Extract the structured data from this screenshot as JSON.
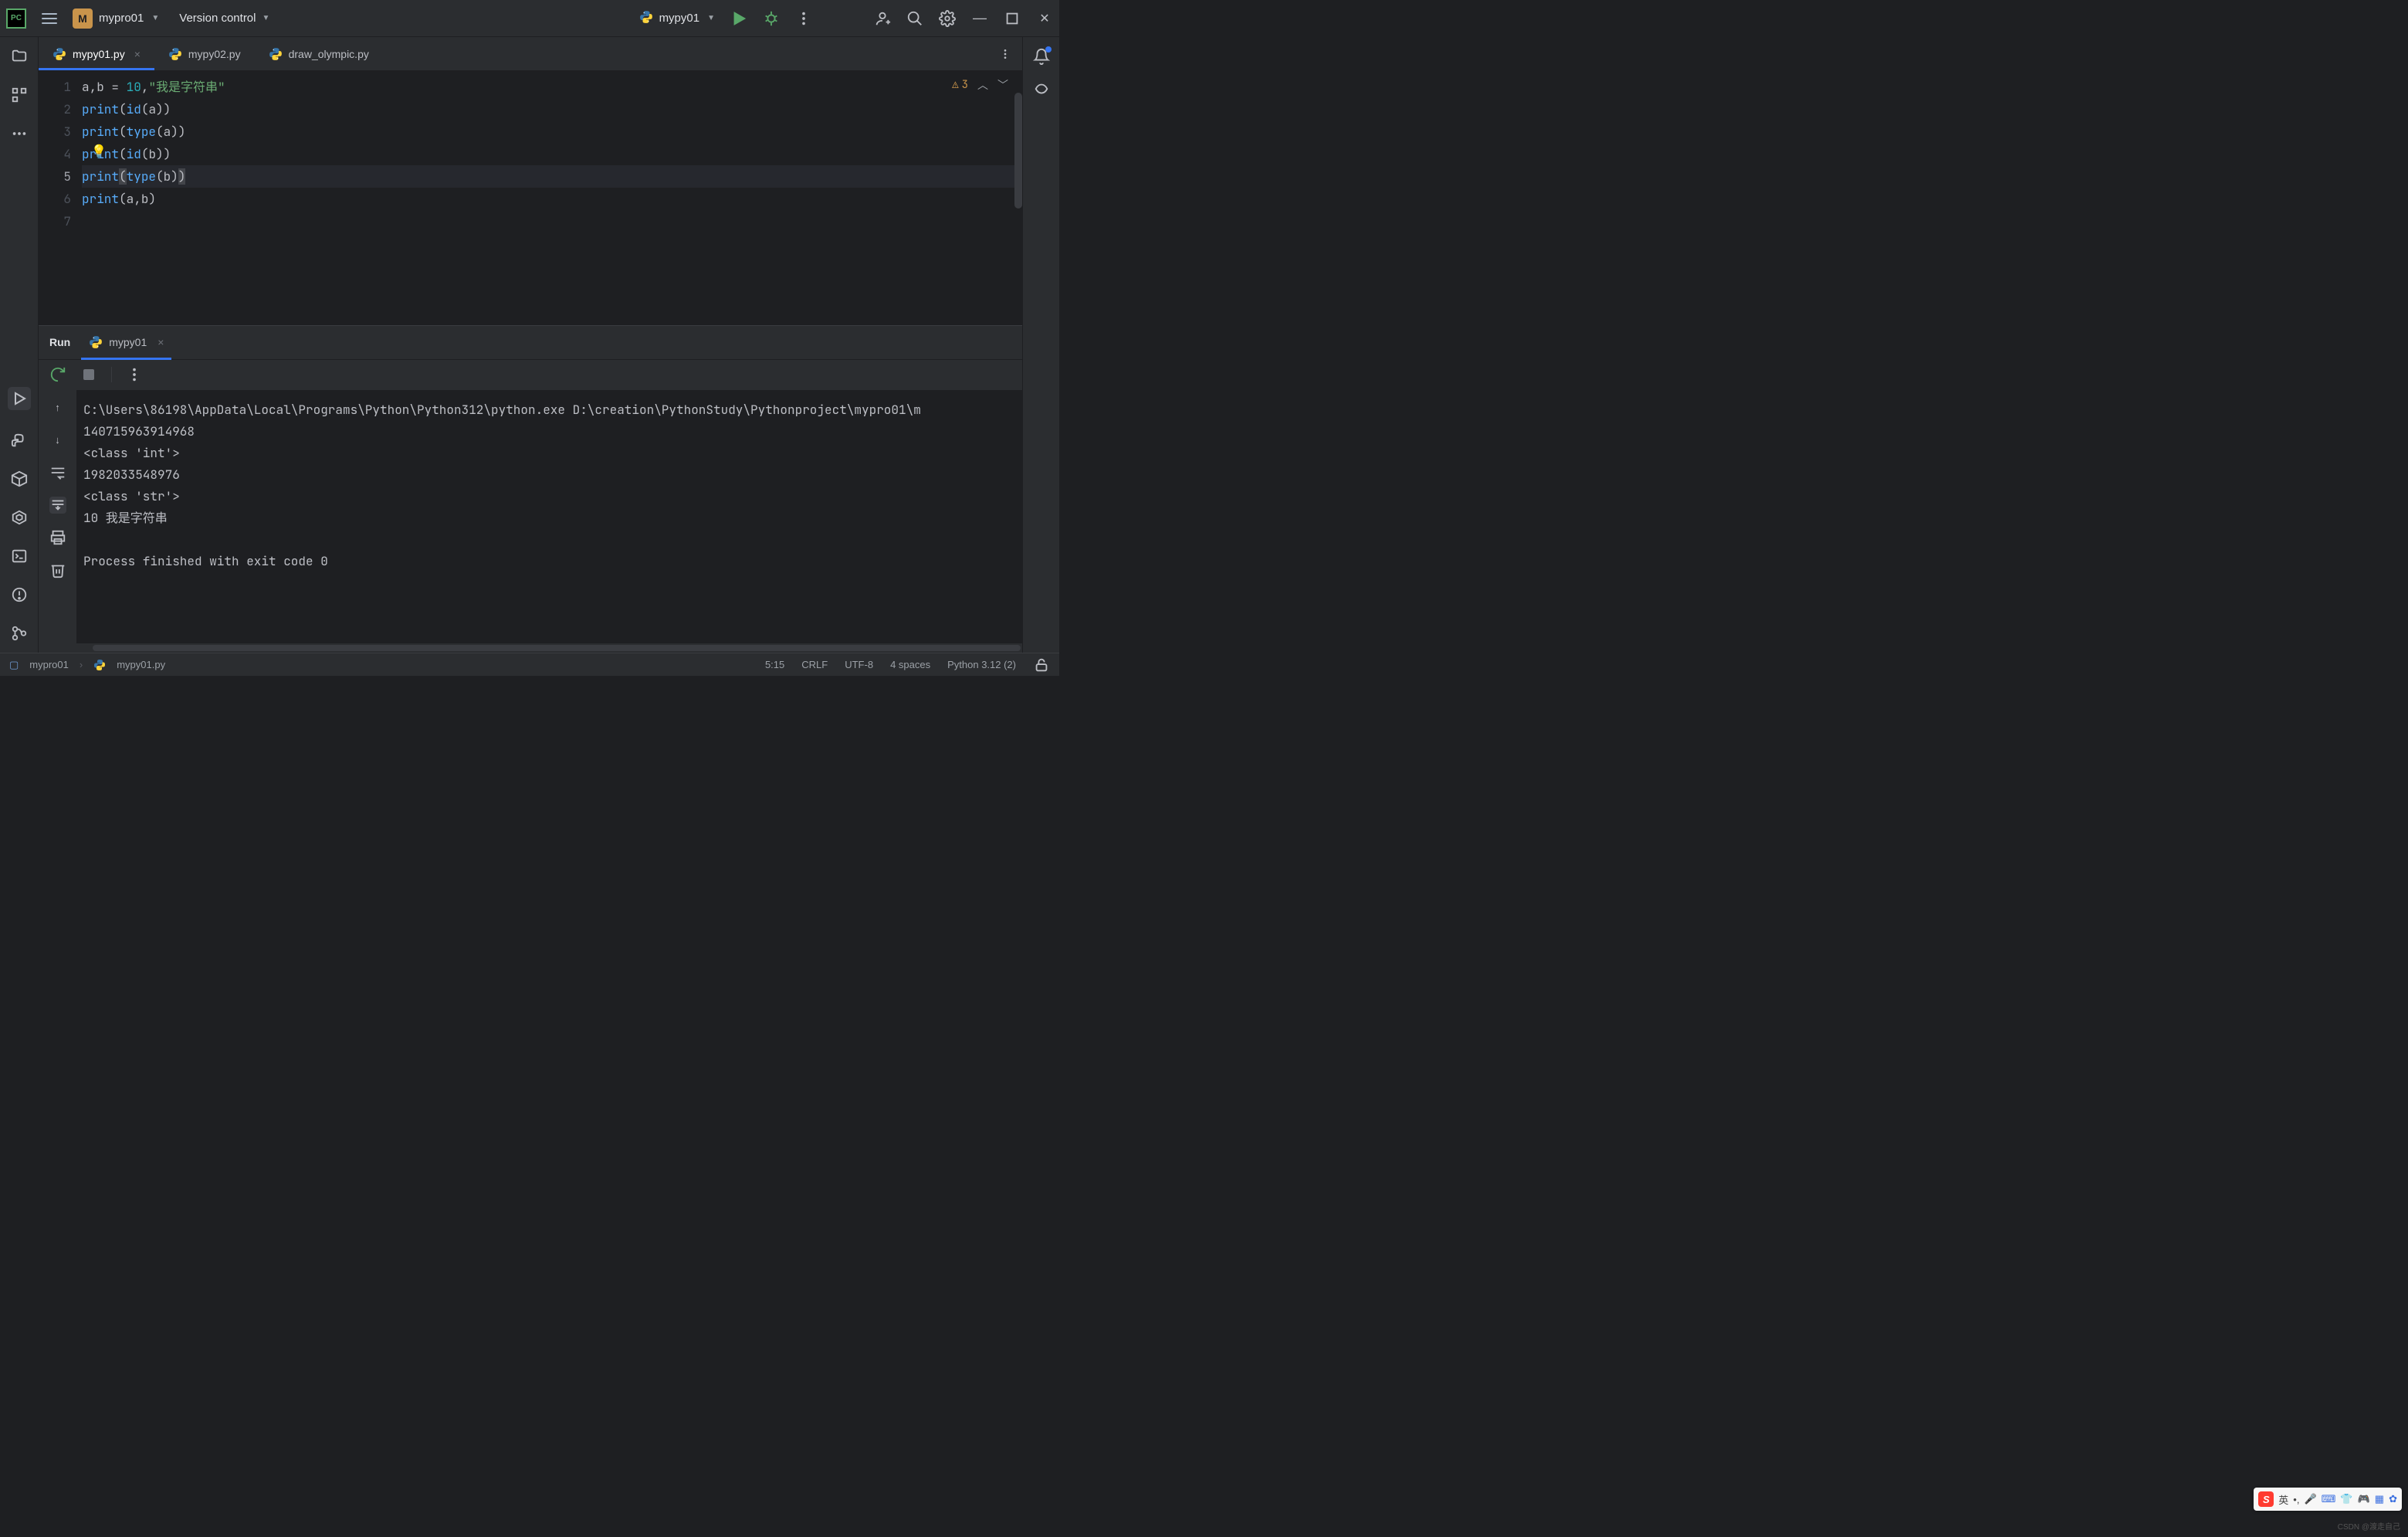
{
  "titlebar": {
    "project_initial": "M",
    "project_name": "mypro01",
    "vcs_label": "Version control",
    "run_config": "mypy01"
  },
  "tabs": [
    {
      "label": "mypy01.py",
      "close": "×",
      "active": true
    },
    {
      "label": "mypy02.py",
      "close": "",
      "active": false
    },
    {
      "label": "draw_olympic.py",
      "close": "",
      "active": false
    }
  ],
  "editor": {
    "warnings_count": "3",
    "gutter": [
      "1",
      "2",
      "3",
      "4",
      "5",
      "6",
      "7"
    ],
    "lines": [
      {
        "tokens": [
          {
            "t": "a",
            "c": "var"
          },
          {
            "t": ",",
            "c": "op"
          },
          {
            "t": "b ",
            "c": "var"
          },
          {
            "t": "=",
            "c": "op"
          },
          {
            "t": " ",
            "c": "op"
          },
          {
            "t": "10",
            "c": "num"
          },
          {
            "t": ",",
            "c": "op"
          },
          {
            "t": "\"我是字符串\"",
            "c": "str"
          }
        ]
      },
      {
        "tokens": [
          {
            "t": "print",
            "c": "builtin"
          },
          {
            "t": "(",
            "c": "op"
          },
          {
            "t": "id",
            "c": "builtin"
          },
          {
            "t": "(",
            "c": "op"
          },
          {
            "t": "a",
            "c": "var"
          },
          {
            "t": ")",
            "c": "op"
          },
          {
            "t": ")",
            "c": "op"
          }
        ]
      },
      {
        "tokens": [
          {
            "t": "print",
            "c": "builtin"
          },
          {
            "t": "(",
            "c": "op"
          },
          {
            "t": "type",
            "c": "builtin"
          },
          {
            "t": "(",
            "c": "op"
          },
          {
            "t": "a",
            "c": "var"
          },
          {
            "t": ")",
            "c": "op"
          },
          {
            "t": ")",
            "c": "op"
          }
        ]
      },
      {
        "tokens": [
          {
            "t": "print",
            "c": "builtin"
          },
          {
            "t": "(",
            "c": "op"
          },
          {
            "t": "id",
            "c": "builtin"
          },
          {
            "t": "(",
            "c": "op"
          },
          {
            "t": "b",
            "c": "var"
          },
          {
            "t": ")",
            "c": "op"
          },
          {
            "t": ")",
            "c": "op"
          }
        ]
      },
      {
        "hl": true,
        "tokens": [
          {
            "t": "print",
            "c": "builtin"
          },
          {
            "t": "(",
            "c": "op",
            "ph": true
          },
          {
            "t": "type",
            "c": "builtin"
          },
          {
            "t": "(",
            "c": "op"
          },
          {
            "t": "b",
            "c": "var"
          },
          {
            "t": ")",
            "c": "op"
          },
          {
            "t": ")",
            "c": "op",
            "ph": true
          }
        ]
      },
      {
        "tokens": [
          {
            "t": "print",
            "c": "builtin"
          },
          {
            "t": "(",
            "c": "op"
          },
          {
            "t": "a",
            "c": "var"
          },
          {
            "t": ",",
            "c": "op"
          },
          {
            "t": "b",
            "c": "var"
          },
          {
            "t": ")",
            "c": "op"
          }
        ]
      },
      {
        "tokens": []
      }
    ]
  },
  "run_panel": {
    "title": "Run",
    "tab_label": "mypy01",
    "close": "×",
    "output_lines": [
      "C:\\Users\\86198\\AppData\\Local\\Programs\\Python\\Python312\\python.exe D:\\creation\\PythonStudy\\Pythonproject\\mypro01\\m",
      "140715963914968",
      "<class 'int'>",
      "1982033548976",
      "<class 'str'>",
      "10 我是字符串",
      "",
      "Process finished with exit code 0"
    ]
  },
  "breadcrumb": {
    "root": "mypro01",
    "file": "mypy01.py"
  },
  "statusbar": {
    "cursor": "5:15",
    "line_sep": "CRLF",
    "encoding": "UTF-8",
    "indent": "4 spaces",
    "interpreter": "Python 3.12 (2)"
  },
  "ime": {
    "lang": "英",
    "punct": "•,"
  },
  "watermark": {
    "l1": "CSDN @渡走自己"
  }
}
